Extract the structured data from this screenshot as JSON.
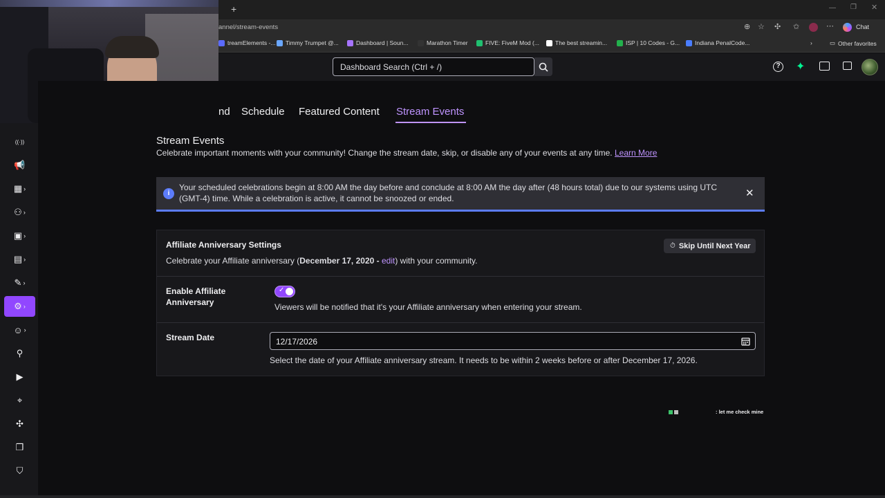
{
  "browser": {
    "url": "annel/stream-events",
    "new_tab": "+",
    "chat_label": "Chat",
    "bookmarks": [
      {
        "label": "treamElements -...",
        "color": "#5b6bff"
      },
      {
        "label": "Timmy Trumpet @...",
        "color": "#6aa7ff"
      },
      {
        "label": "Dashboard | Soun...",
        "color": "#a774ff"
      },
      {
        "label": "Marathon Timer",
        "color": "#333333"
      },
      {
        "label": "FIVE: FiveM Mod (...",
        "color": "#20c070"
      },
      {
        "label": "The best streamin...",
        "color": "#ffffff"
      },
      {
        "label": "ISP | 10 Codes - G...",
        "color": "#22b14c"
      },
      {
        "label": "Indiana PenalCode...",
        "color": "#4a7dff"
      }
    ],
    "other_favorites": "Other favorites"
  },
  "topbar": {
    "search_placeholder": "Dashboard Search (Ctrl + /)",
    "icons": [
      "help-icon",
      "sparkle-icon",
      "inbox-icon",
      "whispers-icon",
      "avatar"
    ]
  },
  "sidebar": {
    "items": [
      {
        "name": "stream-icon"
      },
      {
        "name": "megaphone-icon"
      },
      {
        "name": "insights-icon"
      },
      {
        "name": "community-icon"
      },
      {
        "name": "content-icon"
      },
      {
        "name": "monetization-icon"
      },
      {
        "name": "customization-icon"
      },
      {
        "name": "settings-icon",
        "active": true
      },
      {
        "name": "emotes-icon"
      },
      {
        "name": "add-user-icon"
      },
      {
        "name": "video-icon"
      },
      {
        "name": "creator-camp-icon"
      },
      {
        "name": "extensions-icon"
      },
      {
        "name": "docs-icon"
      },
      {
        "name": "safety-icon"
      }
    ]
  },
  "tabs": [
    {
      "label": "nd"
    },
    {
      "label": "Schedule"
    },
    {
      "label": "Featured Content"
    },
    {
      "label": "Stream Events",
      "active": true
    }
  ],
  "page": {
    "title": "Stream Events",
    "description": "Celebrate important moments with your community! Change the stream date, skip, or disable any of your events at any time.",
    "learn_more": "Learn More"
  },
  "notice": {
    "text": "Your scheduled celebrations begin at 8:00 AM the day before and conclude at 8:00 AM the day after (48 hours total) due to our systems using UTC (GMT-4) time. While a celebration is active, it cannot be snoozed or ended."
  },
  "anniversary": {
    "heading": "Affiliate Anniversary Settings",
    "desc_prefix": "Celebrate your Affiliate anniversary (",
    "date": "December 17, 2020",
    "sep": " - ",
    "edit": "edit",
    "desc_suffix": ") with your community.",
    "skip_button": "Skip Until Next Year",
    "enable_label": "Enable Affiliate Anniversary",
    "enable_on": true,
    "enable_desc": "Viewers will be notified that it's your Affiliate anniversary when entering your stream.",
    "stream_date_label": "Stream Date",
    "stream_date_value": "12/17/2026",
    "stream_date_help": "Select the date of your Affiliate anniversary stream. It needs to be within 2 weeks before or after December 17, 2026."
  },
  "chat_overlay": {
    "user": "",
    "message": ": let me check mine"
  },
  "colors": {
    "accent": "#9147ff",
    "accent_light": "#bf94ff",
    "info": "#5c7cfa"
  }
}
